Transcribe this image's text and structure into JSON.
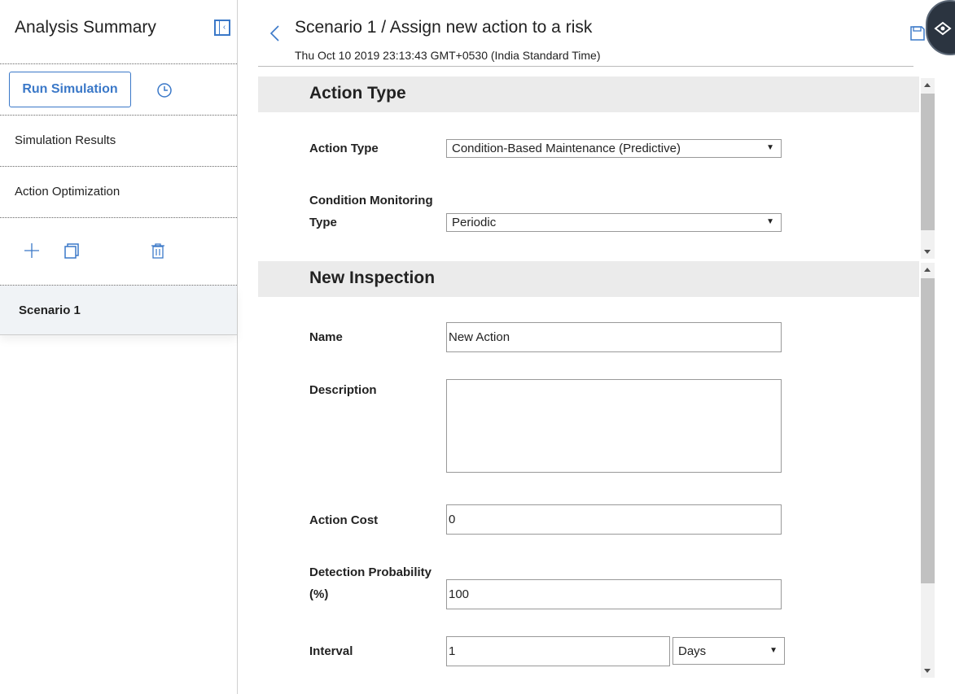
{
  "sidebar": {
    "title": "Analysis Summary",
    "run_button": "Run Simulation",
    "items": [
      {
        "label": "Simulation Results"
      },
      {
        "label": "Action Optimization"
      }
    ],
    "scenarios": [
      {
        "label": "Scenario 1",
        "selected": true
      }
    ]
  },
  "header": {
    "title": "Scenario 1 / Assign new action to a risk",
    "timestamp": "Thu Oct 10 2019 23:13:43 GMT+0530 (India Standard Time)"
  },
  "sections": {
    "action_type": {
      "heading": "Action Type",
      "action_type_label": "Action Type",
      "action_type_value": "Condition-Based Maintenance (Predictive)",
      "cm_type_label_line1": "Condition Monitoring",
      "cm_type_label_line2": "Type",
      "cm_type_value": "Periodic"
    },
    "new_inspection": {
      "heading": "New Inspection",
      "name_label": "Name",
      "name_value": "New Action",
      "description_label": "Description",
      "description_value": "",
      "action_cost_label": "Action Cost",
      "action_cost_value": "0",
      "detection_label_line1": "Detection Probability",
      "detection_label_line2": "(%)",
      "detection_value": "100",
      "interval_label": "Interval",
      "interval_value": "1",
      "interval_unit": "Days"
    }
  },
  "colors": {
    "accent": "#3a78c8",
    "section_bg": "#ebebeb",
    "selected_row_bg": "#f0f3f6"
  },
  "icons": {
    "collapse": "collapse-sidebar-icon",
    "history": "clock-icon",
    "add": "plus-icon",
    "copy": "copy-icon",
    "delete": "trash-icon",
    "back": "chevron-left-icon",
    "save": "save-icon",
    "float": "eye-icon"
  }
}
